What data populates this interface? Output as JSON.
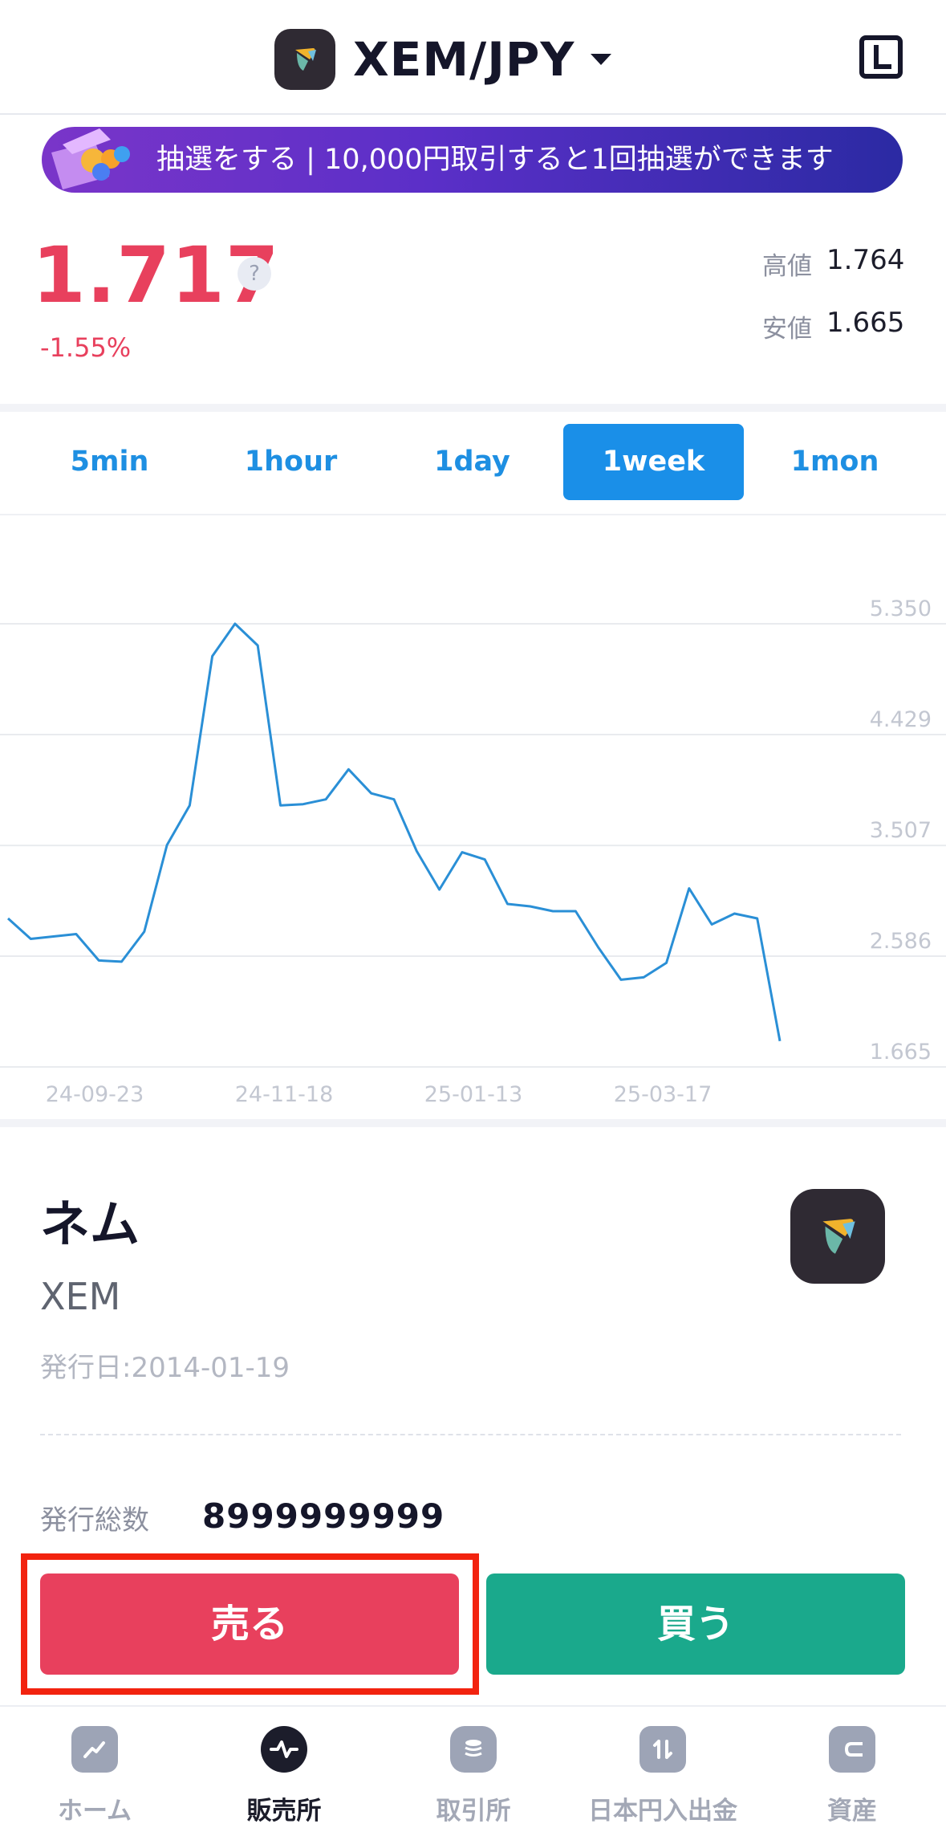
{
  "header": {
    "pair_title": "XEM/JPY",
    "pair_icon": "xem-coin-icon",
    "layout_icon": "layout-icon"
  },
  "banner": {
    "text": "抽選をする | 10,000円取引すると1回抽選ができます"
  },
  "price": {
    "current": "1.717",
    "change": "-1.55%",
    "help": "?",
    "high_label": "高値",
    "high_value": "1.764",
    "low_label": "安値",
    "low_value": "1.665",
    "colors": {
      "down": "#e8405d"
    }
  },
  "tabs": [
    {
      "label": "5min",
      "active": false
    },
    {
      "label": "1hour",
      "active": false
    },
    {
      "label": "1day",
      "active": false
    },
    {
      "label": "1week",
      "active": true
    },
    {
      "label": "1mon",
      "active": false
    }
  ],
  "chart_data": {
    "type": "line",
    "x_labels": [
      "24-09-23",
      "24-11-18",
      "25-01-13",
      "25-03-17"
    ],
    "y_ticks": [
      "5.350",
      "4.429",
      "3.507",
      "2.586",
      "1.665"
    ],
    "ylim": [
      1.665,
      5.35
    ],
    "color": "#2a8fd6",
    "grid": true,
    "series": [
      {
        "values": [
          2.9,
          2.73,
          2.75,
          2.77,
          2.55,
          2.54,
          2.79,
          3.51,
          3.84,
          5.08,
          5.35,
          5.17,
          3.84,
          3.85,
          3.89,
          4.14,
          3.94,
          3.89,
          3.46,
          3.14,
          3.45,
          3.39,
          3.02,
          3.0,
          2.96,
          2.96,
          2.66,
          2.39,
          2.41,
          2.53,
          3.15,
          2.85,
          2.94,
          2.9,
          1.88
        ]
      }
    ]
  },
  "coin": {
    "name": "ネム",
    "symbol": "XEM",
    "issue_date": "発行日:2014-01-19",
    "supply_label": "発行総数",
    "supply_value": "8999999999",
    "icon": "xem-coin-icon"
  },
  "actions": {
    "sell": "売る",
    "buy": "買う",
    "colors": {
      "sell": "#e8405d",
      "buy": "#1aa98c",
      "highlight": "#f2230f"
    }
  },
  "nav": [
    {
      "label": "ホーム",
      "icon": "home-chart-icon",
      "active": false
    },
    {
      "label": "販売所",
      "icon": "trade-wave-icon",
      "active": true
    },
    {
      "label": "取引所",
      "icon": "coin-stack-icon",
      "active": false
    },
    {
      "label": "日本円入出金",
      "icon": "transfer-arrows-icon",
      "active": false
    },
    {
      "label": "資産",
      "icon": "wallet-icon",
      "active": false
    }
  ]
}
